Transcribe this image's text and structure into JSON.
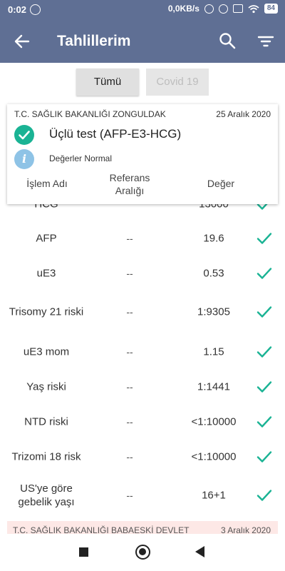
{
  "status_bar": {
    "time": "0:02",
    "network_speed": "0,0KB/s",
    "battery": "84",
    "icons": [
      "whatsapp-icon",
      "mute-icon",
      "alarm-icon",
      "sim-icon",
      "wifi-icon",
      "battery-icon"
    ]
  },
  "app_bar": {
    "title": "Tahlillerim",
    "icons": [
      "back-arrow-icon",
      "search-icon",
      "filter-icon"
    ]
  },
  "filters": {
    "all_label": "Tümü",
    "covid_label": "Covid 19",
    "selected": "Tümü"
  },
  "card": {
    "institution": "T.C. SAĞLIK BAKANLIĞI ZONGULDAK",
    "date": "25 Aralık 2020",
    "test_name": "Üçlü test (AFP-E3-HCG)",
    "status": "Değerler Normal",
    "columns": {
      "name": "İşlem Adı",
      "reference": "Referans Aralığı",
      "value": "Değer"
    }
  },
  "results": [
    {
      "name": "AFP",
      "reference": "--",
      "value": "19.6",
      "status": "normal"
    },
    {
      "name": "uE3",
      "reference": "--",
      "value": "0.53",
      "status": "normal"
    },
    {
      "name": "Trisomy 21 riski",
      "reference": "--",
      "value": "1:9305",
      "status": "normal"
    },
    {
      "name": "uE3 mom",
      "reference": "--",
      "value": "1.15",
      "status": "normal"
    },
    {
      "name": "Yaş riski",
      "reference": "--",
      "value": "1:1441",
      "status": "normal"
    },
    {
      "name": "NTD riski",
      "reference": "--",
      "value": "<1:10000",
      "status": "normal"
    },
    {
      "name": "Trizomi 18 risk",
      "reference": "--",
      "value": "<1:10000",
      "status": "normal"
    },
    {
      "name": "US'ye göre gebelik yaşı",
      "reference": "--",
      "value": "16+1",
      "status": "normal"
    }
  ],
  "next_card": {
    "institution": "T.C. SAĞLIK BAKANLIĞI BABAESKİ DEVLET",
    "date": "3 Aralık 2020"
  },
  "colors": {
    "primary": "#5f6f94",
    "check_green": "#1ab394",
    "info_blue": "#8ec3e6",
    "next_card_bg": "#fde8e6"
  }
}
